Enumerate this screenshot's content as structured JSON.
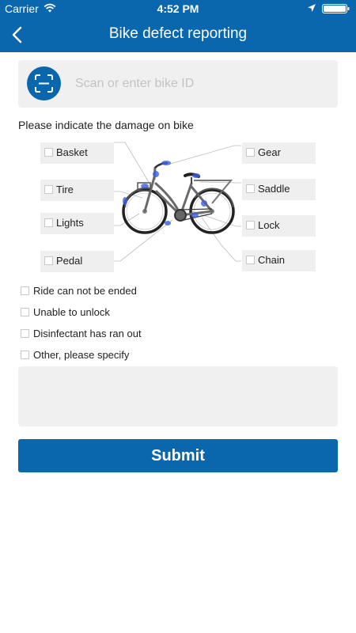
{
  "status_bar": {
    "carrier": "Carrier",
    "time": "4:52 PM"
  },
  "header": {
    "title": "Bike defect reporting",
    "background_color": "#0a67ad"
  },
  "scan": {
    "placeholder": "Scan or enter bike ID",
    "value": "",
    "icon": "scan-icon"
  },
  "damage_prompt": "Please indicate the damage on bike",
  "bike_parts": {
    "basket": "Basket",
    "tire": "Tire",
    "lights": "Lights",
    "pedal": "Pedal",
    "gear": "Gear",
    "saddle": "Saddle",
    "lock": "Lock",
    "chain": "Chain"
  },
  "other_issues": {
    "ride_not_ended": "Ride can not be ended",
    "unable_to_unlock": "Unable to unlock",
    "disinfectant": "Disinfectant has ran out",
    "other": "Other, please specify"
  },
  "other_text": "",
  "submit_label": "Submit",
  "accent_color": "#0a67ad",
  "highlight_color": "#3b5fe0"
}
